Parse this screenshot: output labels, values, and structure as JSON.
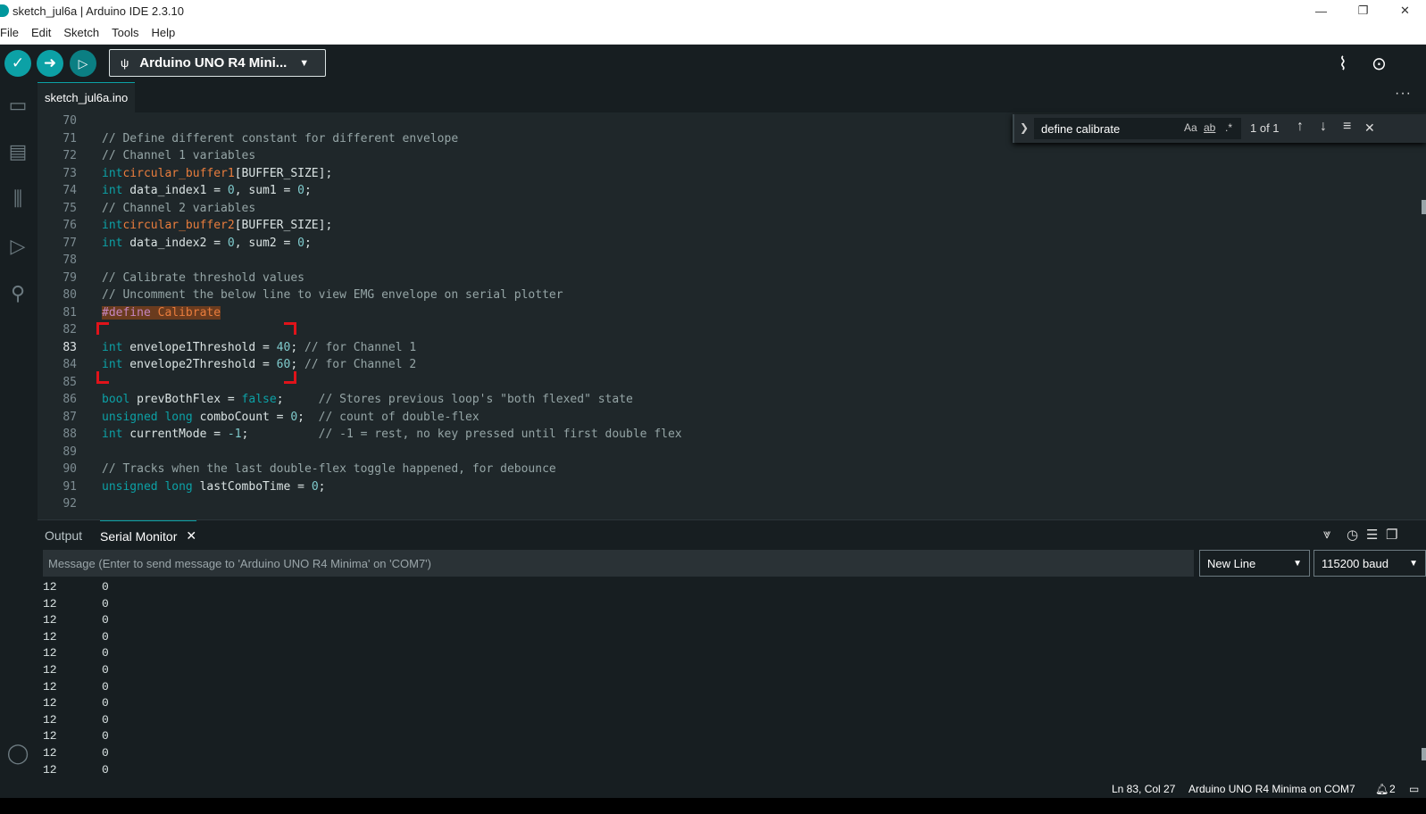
{
  "window": {
    "title": "sketch_jul6a | Arduino IDE 2.3.10",
    "minimize": "—",
    "maximize": "❐",
    "close": "✕"
  },
  "menu": [
    "File",
    "Edit",
    "Sketch",
    "Tools",
    "Help"
  ],
  "toolbar": {
    "verify_icon": "check-icon",
    "upload_icon": "arrow-right-icon",
    "debug_icon": "debug-icon",
    "board": "Arduino UNO R4 Mini...",
    "serial_plotter_icon": "plotter-icon",
    "serial_monitor_icon": "monitor-icon"
  },
  "tab": {
    "file": "sketch_jul6a.ino",
    "more": "···"
  },
  "find": {
    "query": "define calibrate",
    "match_case": "Aa",
    "whole_word": "ab",
    "regex": ".*",
    "count": "1 of 1"
  },
  "code": {
    "lines": [
      {
        "n": "70",
        "t": ""
      },
      {
        "n": "71",
        "t": "// Define different constant for different envelope"
      },
      {
        "n": "72",
        "t": "// Channel 1 variables"
      },
      {
        "n": "73",
        "kw": "int",
        "fn": "circular_buffer1",
        "rest": "[BUFFER_SIZE];"
      },
      {
        "n": "74",
        "kw": "int",
        "rest": " data_index1 = ",
        "a": "0",
        "b": ", sum1 = ",
        "c": "0",
        "d": ";"
      },
      {
        "n": "75",
        "t": "// Channel 2 variables"
      },
      {
        "n": "76",
        "kw": "int",
        "fn": "circular_buffer2",
        "rest": "[BUFFER_SIZE];"
      },
      {
        "n": "77",
        "kw": "int",
        "rest": " data_index2 = ",
        "a": "0",
        "b": ", sum2 = ",
        "c": "0",
        "d": ";"
      },
      {
        "n": "78",
        "t": ""
      },
      {
        "n": "79",
        "t": "// Calibrate threshold values"
      },
      {
        "n": "80",
        "t": "// Uncomment the below line to view EMG envelope on serial plotter"
      },
      {
        "n": "81",
        "pp": "#define",
        "hlrest": " Calibrate"
      },
      {
        "n": "82",
        "t": ""
      },
      {
        "n": "83",
        "kw": "int",
        "rest": " envelope1Threshold = ",
        "a": "40",
        "b": "; ",
        "cm": "// for Channel 1"
      },
      {
        "n": "84",
        "kw": "int",
        "rest": " envelope2Threshold = ",
        "a": "60",
        "b": "; ",
        "cm": "// for Channel 2"
      },
      {
        "n": "85",
        "t": ""
      },
      {
        "n": "86",
        "kw": "bool",
        "rest": " prevBothFlex = ",
        "kw2": "false",
        "b": ";     ",
        "cm": "// Stores previous loop's \"both flexed\" state"
      },
      {
        "n": "87",
        "kw": "unsigned long",
        "rest": " comboCount = ",
        "a": "0",
        "b": ";  ",
        "cm": "// count of double-flex"
      },
      {
        "n": "88",
        "kw": "int",
        "rest": " currentMode = ",
        "a": "-1",
        "b": ";          ",
        "cm": "// -1 = rest, no key pressed until first double flex"
      },
      {
        "n": "89",
        "t": ""
      },
      {
        "n": "90",
        "t": "// Tracks when the last double-flex toggle happened, for debounce"
      },
      {
        "n": "91",
        "kw": "unsigned long",
        "rest": " lastComboTime = ",
        "a": "0",
        "b": ";"
      },
      {
        "n": "92",
        "t": ""
      }
    ]
  },
  "panel": {
    "tab_output": "Output",
    "tab_serial": "Serial Monitor",
    "message_placeholder": "Message (Enter to send message to 'Arduino UNO R4 Minima' on 'COM7')",
    "line_ending": "New Line",
    "baud": "115200 baud"
  },
  "serial_output": [
    [
      "12",
      "0"
    ],
    [
      "12",
      "0"
    ],
    [
      "12",
      "0"
    ],
    [
      "12",
      "0"
    ],
    [
      "12",
      "0"
    ],
    [
      "12",
      "0"
    ],
    [
      "12",
      "0"
    ],
    [
      "12",
      "0"
    ],
    [
      "12",
      "0"
    ],
    [
      "12",
      "0"
    ],
    [
      "12",
      "0"
    ],
    [
      "12",
      "0"
    ]
  ],
  "status": {
    "position": "Ln 83, Col 27",
    "board": "Arduino UNO R4 Minima on COM7",
    "notifications": "2"
  }
}
